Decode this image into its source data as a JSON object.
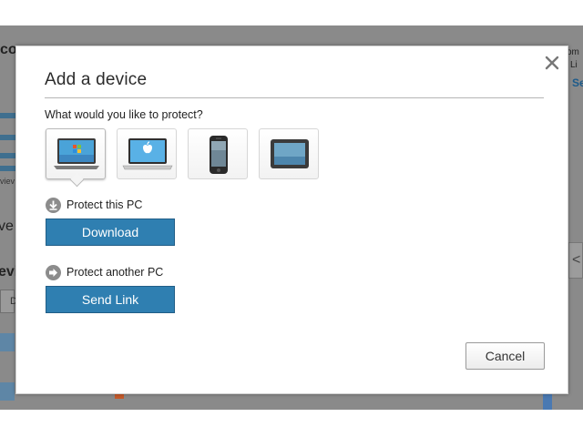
{
  "background": {
    "left_title": "co",
    "left_view": "viev",
    "left_v1": "ve",
    "left_v2": "evi",
    "left_box_letter": "D",
    "right_line1": "om",
    "right_line2": "Li",
    "right_line3": "Se",
    "right_tab_glyph": "<"
  },
  "modal": {
    "title": "Add a device",
    "question": "What would you like to protect?",
    "devices": [
      {
        "name": "windows-pc",
        "icon": "windows-laptop-icon",
        "selected": true
      },
      {
        "name": "mac",
        "icon": "apple-laptop-icon",
        "selected": false
      },
      {
        "name": "smartphone",
        "icon": "smartphone-icon",
        "selected": false
      },
      {
        "name": "tablet",
        "icon": "tablet-icon",
        "selected": false
      }
    ],
    "protect_this": {
      "label": "Protect this PC",
      "icon": "download-circle-icon",
      "button_label": "Download"
    },
    "protect_another": {
      "label": "Protect another PC",
      "icon": "arrow-right-circle-icon",
      "button_label": "Send Link"
    },
    "cancel_label": "Cancel",
    "close_icon": "close-icon"
  },
  "colors": {
    "primary_button": "#2f7fb1",
    "backdrop": "#8a8a8a",
    "section_icon": "#8c8c8c"
  }
}
